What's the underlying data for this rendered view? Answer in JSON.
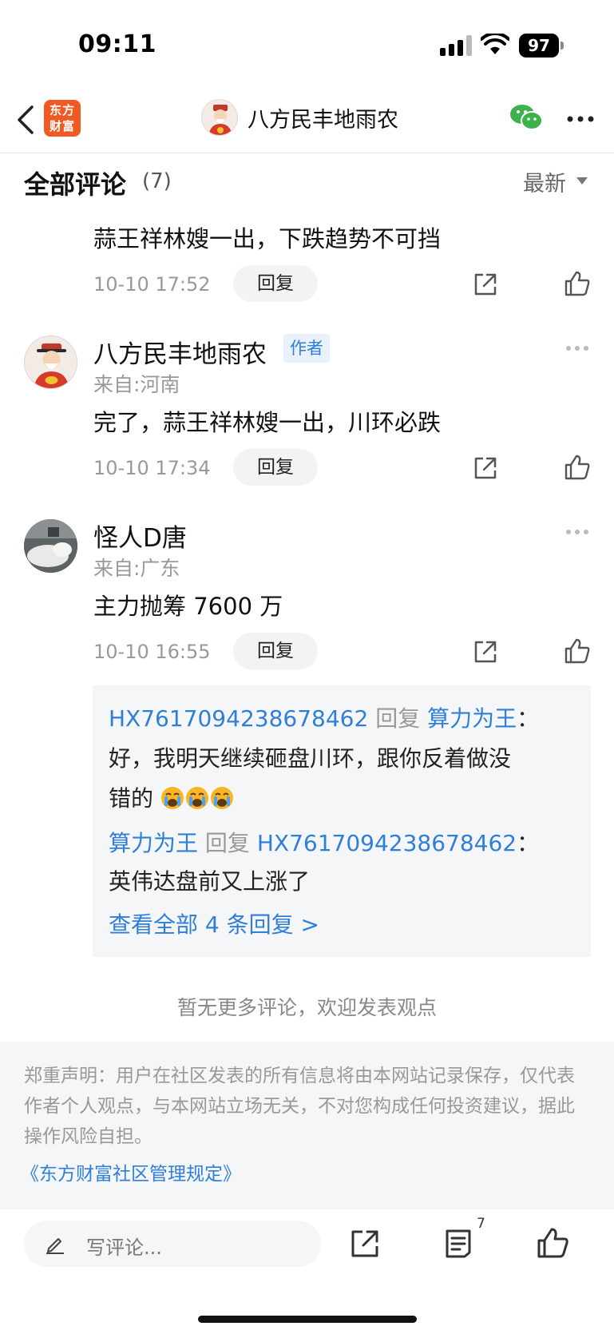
{
  "status_bar": {
    "time": "09:11",
    "battery": "97"
  },
  "nav": {
    "app_logo_line1": "东方",
    "app_logo_line2": "财富",
    "title": "八方民丰地雨农",
    "brand_color": "#f05a22"
  },
  "section": {
    "title": "全部评论",
    "count": "(7)",
    "sort_label": "最新"
  },
  "comments": [
    {
      "text": "蒜王祥林嫂一出，下跌趋势不可挡",
      "time": "10-10 17:52",
      "reply_label": "回复"
    },
    {
      "user": "八方民丰地雨农",
      "badge": "作者",
      "location": "来自:河南",
      "text": "完了，蒜王祥林嫂一出，川环必跌",
      "time": "10-10 17:34",
      "reply_label": "回复"
    },
    {
      "user": "怪人D唐",
      "location": "来自:广东",
      "text": "主力抛筹 7600 万",
      "time": "10-10 16:55",
      "reply_label": "回复"
    }
  ],
  "replies": [
    {
      "from": "HX7617094238678462",
      "verb": "回复",
      "to": "算力为王",
      "colon": "：",
      "line1": "好，我明天继续砸盘川环，跟你反着做没",
      "line2": "错的"
    },
    {
      "from": "算力为王",
      "verb": "回复",
      "to": "HX7617094238678462",
      "colon": "：",
      "line1": "英伟达盘前又上涨了"
    }
  ],
  "view_all_replies": "查看全部 4 条回复 >",
  "no_more_text": "暂无更多评论，欢迎发表观点",
  "disclaimer": {
    "text": "郑重声明：用户在社区发表的所有信息将由本网站记录保存，仅代表作者个人观点，与本网站立场无关，不对您构成任何投资建议，据此操作风险自担。",
    "link": "《东方财富社区管理规定》"
  },
  "bottom_bar": {
    "placeholder": "写评论...",
    "comments_count": "7"
  },
  "colors": {
    "link_blue": "#2f7fd8",
    "muted_grey": "#999999"
  }
}
